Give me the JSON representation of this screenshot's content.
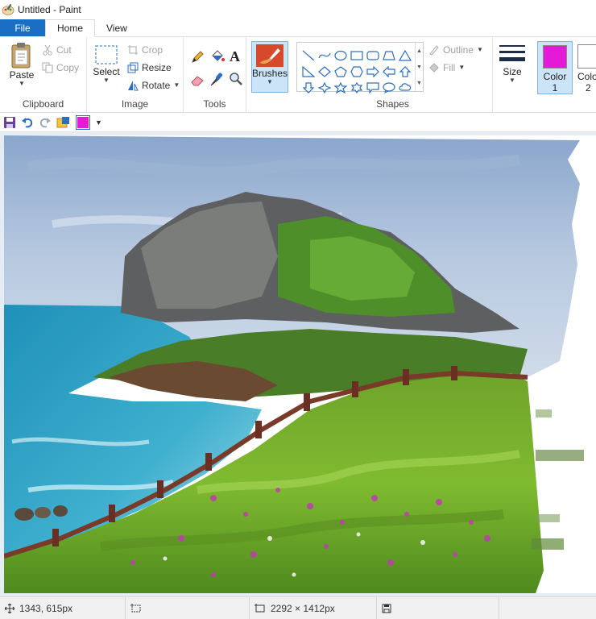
{
  "window": {
    "title": "Untitled - Paint"
  },
  "tabs": [
    {
      "label": "File"
    },
    {
      "label": "Home"
    },
    {
      "label": "View"
    }
  ],
  "ribbon": {
    "clipboard": {
      "label": "Clipboard",
      "paste": "Paste",
      "cut": "Cut",
      "copy": "Copy"
    },
    "image": {
      "label": "Image",
      "select": "Select",
      "crop": "Crop",
      "resize": "Resize",
      "rotate": "Rotate"
    },
    "tools": {
      "label": "Tools"
    },
    "brushes": {
      "label": "Brushes"
    },
    "shapes": {
      "label": "Shapes",
      "outline": "Outline",
      "fill": "Fill"
    },
    "size": {
      "label": "Size"
    },
    "color1": {
      "label": "Color",
      "num": "1",
      "value": "#e619d6"
    },
    "color2": {
      "label": "Colo",
      "num": "2"
    }
  },
  "qat": {
    "current_color": "#e619d6"
  },
  "status": {
    "cursor": "1343, 615px",
    "image_size": "2292 × 1412px"
  },
  "icons": [
    "paint-app-icon",
    "paste-icon",
    "cut-icon",
    "copy-icon",
    "select-icon",
    "crop-icon",
    "resize-icon",
    "rotate-icon",
    "pencil-icon",
    "fill-icon",
    "text-icon",
    "eraser-icon",
    "color-picker-icon",
    "magnifier-icon",
    "brush-icon",
    "save-icon",
    "undo-icon",
    "redo-icon",
    "move-cursor-icon",
    "selection-size-icon",
    "image-size-icon",
    "disk-icon"
  ]
}
